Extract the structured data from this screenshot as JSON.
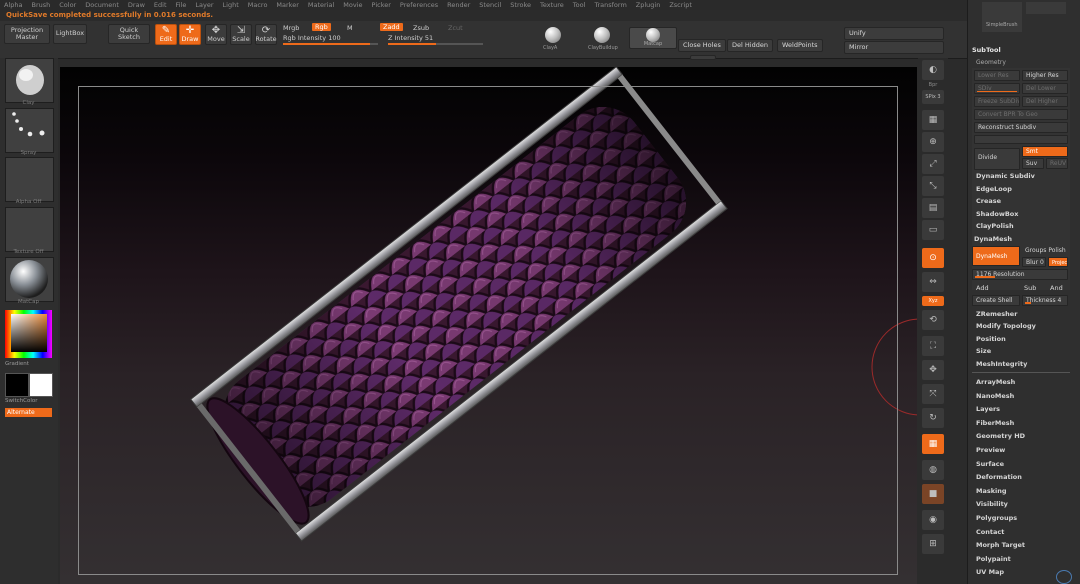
{
  "menu": [
    "Alpha",
    "Brush",
    "Color",
    "Document",
    "Draw",
    "Edit",
    "File",
    "Layer",
    "Light",
    "Macro",
    "Marker",
    "Material",
    "Movie",
    "Picker",
    "Preferences",
    "Render",
    "Stencil",
    "Stroke",
    "Texture",
    "Tool",
    "Transform",
    "Zplugin",
    "Zscript"
  ],
  "status_message": "QuickSave completed successfully in 0.016 seconds.",
  "toolbar": {
    "projection_master": "Projection Master",
    "lightbox": "LightBox",
    "quick_sketch": "Quick Sketch",
    "edit": "Edit",
    "draw": "Draw",
    "move": "Move",
    "scale": "Scale",
    "rotate": "Rotate",
    "mrgb": "Mrgb",
    "rgb": "Rgb",
    "m": "M",
    "rgb_intensity": "Rgb Intensity 100",
    "zadd": "Zadd",
    "zsub": "Zsub",
    "zcut": "Zcut",
    "z_intensity": "Z Intensity 51",
    "clay_label": "ClayA",
    "claybuildup": "ClayBuildup",
    "material_label": "Matcap",
    "close_holes": "Close Holes",
    "del_hidden": "Del Hidden",
    "weld_points": "WeldPoints",
    "unify": "Unify",
    "mirror": "Mirror"
  },
  "left_shelf": {
    "brush_label": "Clay",
    "stroke_label": "Spray",
    "alpha_label": "Alpha Off",
    "texture_label": "Texture Off",
    "material_label": "MatCap",
    "gradient": "Gradient",
    "switch_color": "SwitchColor",
    "alternate": "Alternate"
  },
  "right_strip": [
    "Bpr",
    "SPix 3",
    "Scroll",
    "Zoom",
    "Actual",
    "AAHalf",
    "Persp",
    "Floor",
    "Local",
    "L.Sym",
    "Xyz",
    "Frame",
    "Move",
    "Scale",
    "Rotate",
    "PolyF",
    "Transp",
    "Solo",
    "Xpose"
  ],
  "subtool_panel": {
    "top_icon": "SimpleBrush",
    "top_icon2": "Sphere",
    "subtool": "SubTool",
    "geometry": "Geometry",
    "lower_res": "Lower Res",
    "higher_res": "Higher Res",
    "sdiv": "SDiv",
    "del_lower": "Del Lower",
    "del_higher": "Del Higher",
    "freeze_subdiv": "Freeze SubDiv",
    "reconstruct_subdiv": "Reconstruct Subdiv",
    "convert_bpr": "Convert BPR To Geo",
    "divide": "Divide",
    "smt": "Smt",
    "suv": "Suv",
    "rel": "ReUV",
    "dynamic_subdiv": "Dynamic Subdiv",
    "edge_loop": "EdgeLoop",
    "crease": "Crease",
    "shadow_box": "ShadowBox",
    "clay_polish": "ClayPolish",
    "dynamesh_head": "DynaMesh",
    "dynamesh_btn": "DynaMesh",
    "groups": "Groups",
    "polish": "Polish",
    "blur": "Blur 0",
    "project": "Project",
    "resolution": "1176 Resolution",
    "add": "Add",
    "sub": "Sub",
    "and": "And",
    "create_shell": "Create Shell",
    "thickness": "Thickness 4",
    "zremesher": "ZRemesher",
    "modify_topology": "Modify Topology",
    "position": "Position",
    "size": "Size",
    "mesh_integrity": "MeshIntegrity",
    "sections": [
      "ArrayMesh",
      "NanoMesh",
      "Layers",
      "FiberMesh",
      "Geometry HD",
      "Preview",
      "Surface",
      "Deformation",
      "Masking",
      "Visibility",
      "Polygroups",
      "Contact",
      "Morph Target",
      "Polypaint",
      "UV Map"
    ]
  },
  "colors": {
    "accent": "#ee6a1a",
    "panel": "#2f2f2f",
    "viewport_top": "#020202",
    "viewport_bottom": "#343032"
  }
}
